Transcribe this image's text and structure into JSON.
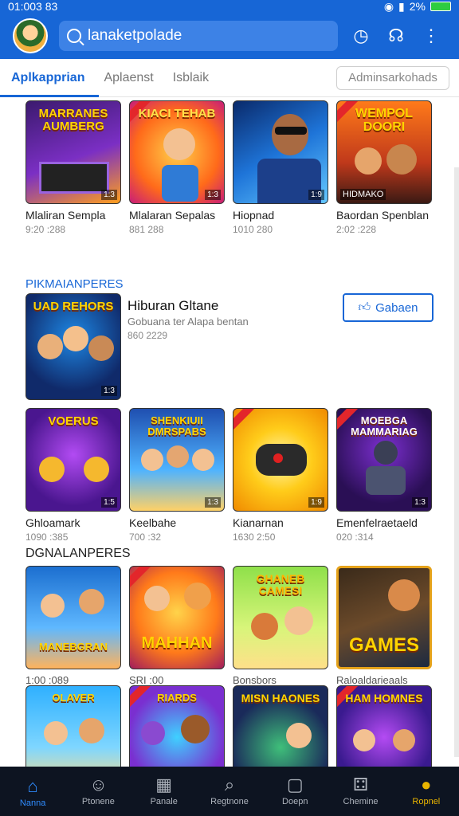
{
  "status": {
    "time": "01:003 83",
    "battery": "2%"
  },
  "search": {
    "placeholder": "lanaketpolade"
  },
  "tabs": [
    {
      "label": "Aplkapprian",
      "active": true
    },
    {
      "label": "Aplaenst",
      "active": false
    },
    {
      "label": "Isblaik",
      "active": false
    }
  ],
  "tab_pill": "Adminsarkohads",
  "row1": [
    {
      "title": "Mlaliran Sempla",
      "meta": "9:20 :288",
      "art": "MARRANES AUMBERG",
      "badge": "1:3"
    },
    {
      "title": "Mlalaran Sepalas",
      "meta": "881 288",
      "art": "KIACI TEHAB",
      "badge": "1:3"
    },
    {
      "title": "Hiopnad",
      "meta": "1010 280",
      "art": "",
      "badge": "1:9"
    },
    {
      "title": "Baordan Spenblan",
      "meta": "2:02 :228",
      "art": "WEMPOL DOORI",
      "badge": "HIDMAKO"
    }
  ],
  "section1": "PIKMAIANPERES",
  "featured": {
    "title": "Hiburan Gltane",
    "subtitle": "Gobuana ter Alapa bentan",
    "meta": "860 2229",
    "art": "UAD REHORS",
    "badge": "1:3",
    "button": "Gabaen"
  },
  "row2": [
    {
      "title": "Ghloamark",
      "meta": "1090 :385",
      "art": "VOERUS",
      "badge": "1:5"
    },
    {
      "title": "Keelbahe",
      "meta": "700 :32",
      "art": "SHENKIUII DMRSPABS",
      "badge": "1:3"
    },
    {
      "title": "Kianarnan",
      "meta": "1630 2:50",
      "art": "",
      "badge": "1:9"
    },
    {
      "title": "Emenfelraetaeld",
      "meta": "020 :314",
      "art": "MOEBGA MAMMARIAG",
      "badge": "1:3"
    }
  ],
  "section2": "DGNALANPERES",
  "row3": [
    {
      "title": "",
      "meta": "1:00 :089",
      "art": "MANEBGRAN",
      "badge": ""
    },
    {
      "title": "",
      "meta": "SRI :00",
      "art": "MAHHAN",
      "badge": ""
    },
    {
      "title": "",
      "meta": "Bonsbors",
      "art": "GHANEB CAMESI",
      "badge": ""
    },
    {
      "title": "",
      "meta": "Raloaldarieaals",
      "art": "GAMES",
      "badge": ""
    }
  ],
  "row4": [
    {
      "art": "OLAVER"
    },
    {
      "art": "RIARDS"
    },
    {
      "art": "MISN HAONES"
    },
    {
      "art": "HAM HOMNES"
    }
  ],
  "bottom_nav": [
    {
      "label": "Nanna",
      "glyph": "⌂",
      "state": "active"
    },
    {
      "label": "Ptonene",
      "glyph": "☺",
      "state": ""
    },
    {
      "label": "Panale",
      "glyph": "▦",
      "state": ""
    },
    {
      "label": "Regtnone",
      "glyph": "⌕",
      "state": ""
    },
    {
      "label": "Doepn",
      "glyph": "▢",
      "state": ""
    },
    {
      "label": "Chemine",
      "glyph": "⚃",
      "state": ""
    },
    {
      "label": "Ropnel",
      "glyph": "●",
      "state": "gold"
    }
  ],
  "colors": {
    "primary": "#1766d6",
    "nav_bg": "#0d1421",
    "nav_active": "#2f8cff",
    "nav_gold": "#e9b400"
  }
}
